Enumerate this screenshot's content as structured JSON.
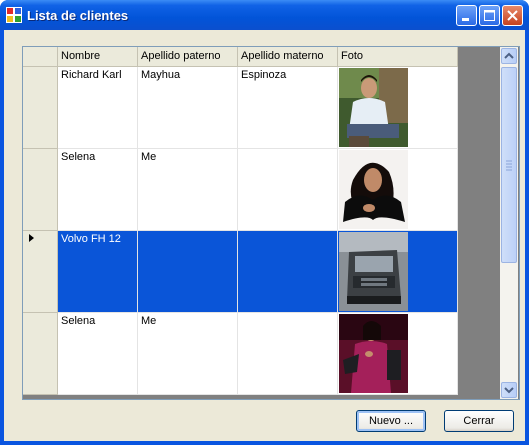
{
  "window": {
    "title": "Lista de clientes"
  },
  "grid": {
    "columns": [
      "Nombre",
      "Apellido paterno",
      "Apellido materno",
      "Foto"
    ],
    "rows": [
      {
        "nombre": "Richard Karl",
        "paterno": "Mayhua",
        "materno": "Espinoza",
        "foto": "person-photo"
      },
      {
        "nombre": "Selena",
        "paterno": "Me",
        "materno": "",
        "foto": "person-photo"
      },
      {
        "nombre": "Volvo FH 12",
        "paterno": "",
        "materno": "",
        "foto": "truck-photo",
        "selected": true
      },
      {
        "nombre": "Selena",
        "paterno": "Me",
        "materno": "",
        "foto": "person-photo"
      }
    ],
    "selection_color": "#0a55d8"
  },
  "buttons": {
    "nuevo": "Nuevo ...",
    "cerrar": "Cerrar"
  },
  "icons": {
    "app": "app-grid-icon",
    "minimize": "minimize-icon",
    "maximize": "maximize-icon",
    "close": "close-icon",
    "row_indicator": "row-pointer-icon"
  }
}
